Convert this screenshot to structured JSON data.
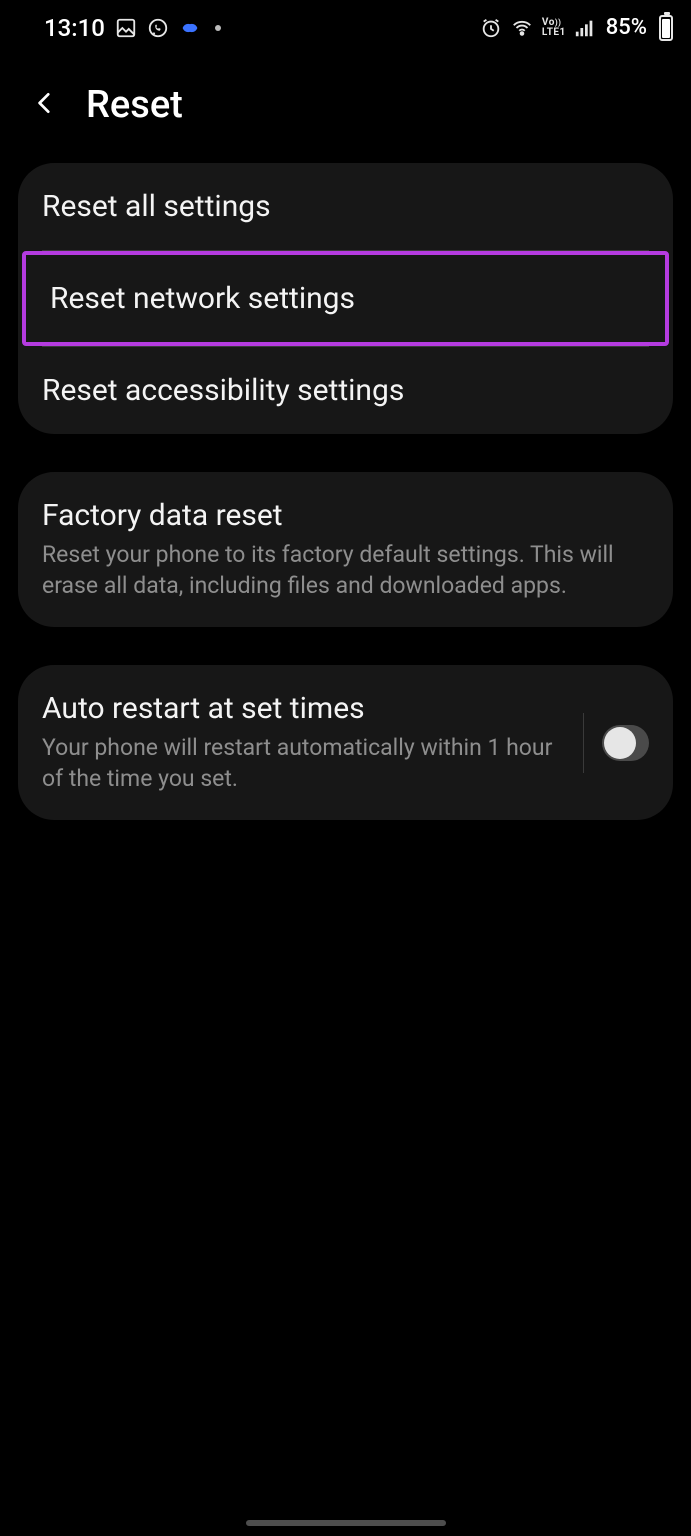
{
  "status": {
    "time": "13:10",
    "battery_pct": "85%",
    "icons_left": [
      "gallery",
      "whatsapp",
      "swirl",
      "dot"
    ],
    "icons_right": [
      "alarm",
      "wifi",
      "volte",
      "signal"
    ]
  },
  "header": {
    "title": "Reset"
  },
  "card1": {
    "items": [
      {
        "label": "Reset all settings",
        "highlighted": false
      },
      {
        "label": "Reset network settings",
        "highlighted": true
      },
      {
        "label": "Reset accessibility settings",
        "highlighted": false
      }
    ]
  },
  "card2": {
    "title": "Factory data reset",
    "sub": "Reset your phone to its factory default settings. This will erase all data, including files and downloaded apps."
  },
  "card3": {
    "title": "Auto restart at set times",
    "sub": "Your phone will restart automatically within 1 hour of the time you set.",
    "toggle": false
  }
}
